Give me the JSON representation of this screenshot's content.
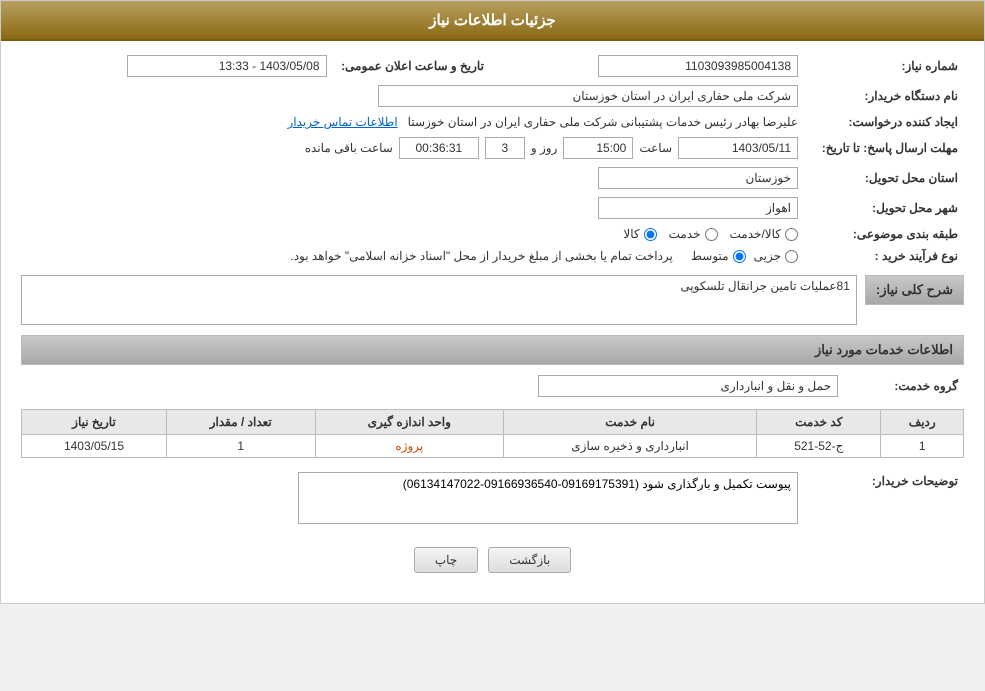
{
  "header": {
    "title": "جزئیات اطلاعات نیاز"
  },
  "fields": {
    "need_number_label": "شماره نیاز:",
    "need_number_value": "1103093985004138",
    "announcement_label": "تاریخ و ساعت اعلان عمومی:",
    "announcement_value": "1403/05/08 - 13:33",
    "buyer_org_label": "نام دستگاه خریدار:",
    "buyer_org_value": "شرکت ملی حفاری ایران در استان خوزستان",
    "requester_label": "ایجاد کننده درخواست:",
    "requester_value": "علیرضا بهادر رئیس خدمات پشتیبانی شرکت ملی حفاری ایران در استان خوزستا",
    "contact_link": "اطلاعات تماس خریدار",
    "deadline_label": "مهلت ارسال پاسخ: تا تاریخ:",
    "deadline_date": "1403/05/11",
    "deadline_time_label": "ساعت",
    "deadline_time": "15:00",
    "deadline_days_label": "روز و",
    "deadline_days": "3",
    "deadline_remaining_label": "ساعت باقی مانده",
    "deadline_remaining": "00:36:31",
    "province_label": "استان محل تحویل:",
    "province_value": "خوزستان",
    "city_label": "شهر محل تحویل:",
    "city_value": "اهواز",
    "category_label": "طبقه بندی موضوعی:",
    "category_options": [
      "کالا",
      "خدمت",
      "کالا/خدمت"
    ],
    "category_selected": "کالا",
    "purchase_type_label": "نوع فرآیند خرید :",
    "purchase_type_options": [
      "جزیی",
      "متوسط"
    ],
    "purchase_type_selected": "متوسط",
    "purchase_type_note": "پرداخت تمام یا بخشی از مبلغ خریدار از محل \"اسناد خزانه اسلامی\" خواهد بود.",
    "general_desc_label": "شرح کلی نیاز:",
    "general_desc_value": "81عملیات تامین جرانقال تلسکوپی",
    "services_info_label": "اطلاعات خدمات مورد نیاز",
    "service_group_label": "گروه خدمت:",
    "service_group_value": "حمل و نقل و انبارداری",
    "table": {
      "headers": [
        "ردیف",
        "کد خدمت",
        "نام خدمت",
        "واحد اندازه گیری",
        "تعداد / مقدار",
        "تاریخ نیاز"
      ],
      "rows": [
        {
          "row": "1",
          "code": "ج-52-521",
          "name": "انبارداری و ذخیره سازی",
          "unit": "پروژه",
          "quantity": "1",
          "date": "1403/05/15"
        }
      ]
    },
    "buyer_desc_label": "توضیحات خریدار:",
    "buyer_desc_value": "پیوست تکمیل و بارگذاری شود (09169175391-09166936540-06134147022)"
  },
  "buttons": {
    "print": "چاپ",
    "back": "بازگشت"
  }
}
